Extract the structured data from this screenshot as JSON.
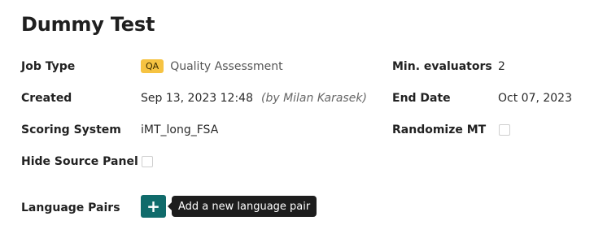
{
  "page": {
    "title": "Dummy Test"
  },
  "fields": {
    "job_type": {
      "label": "Job Type",
      "badge": "QA",
      "value": "Quality Assessment"
    },
    "created": {
      "label": "Created",
      "value": "Sep 13, 2023 12:48",
      "by": "(by Milan Karasek)"
    },
    "scoring_system": {
      "label": "Scoring System",
      "value": "iMT_long_FSA"
    },
    "hide_source_panel": {
      "label": "Hide Source Panel",
      "checked": false
    },
    "min_evaluators": {
      "label": "Min. evaluators",
      "value": "2"
    },
    "end_date": {
      "label": "End Date",
      "value": "Oct 07, 2023"
    },
    "randomize_mt": {
      "label": "Randomize MT",
      "checked": false
    },
    "language_pairs": {
      "label": "Language Pairs",
      "add_button_icon": "plus-icon",
      "add_tooltip": "Add a new language pair"
    }
  },
  "colors": {
    "badge": "#f6c342",
    "add_button": "#106b6b",
    "tooltip": "#1d1d1d"
  }
}
